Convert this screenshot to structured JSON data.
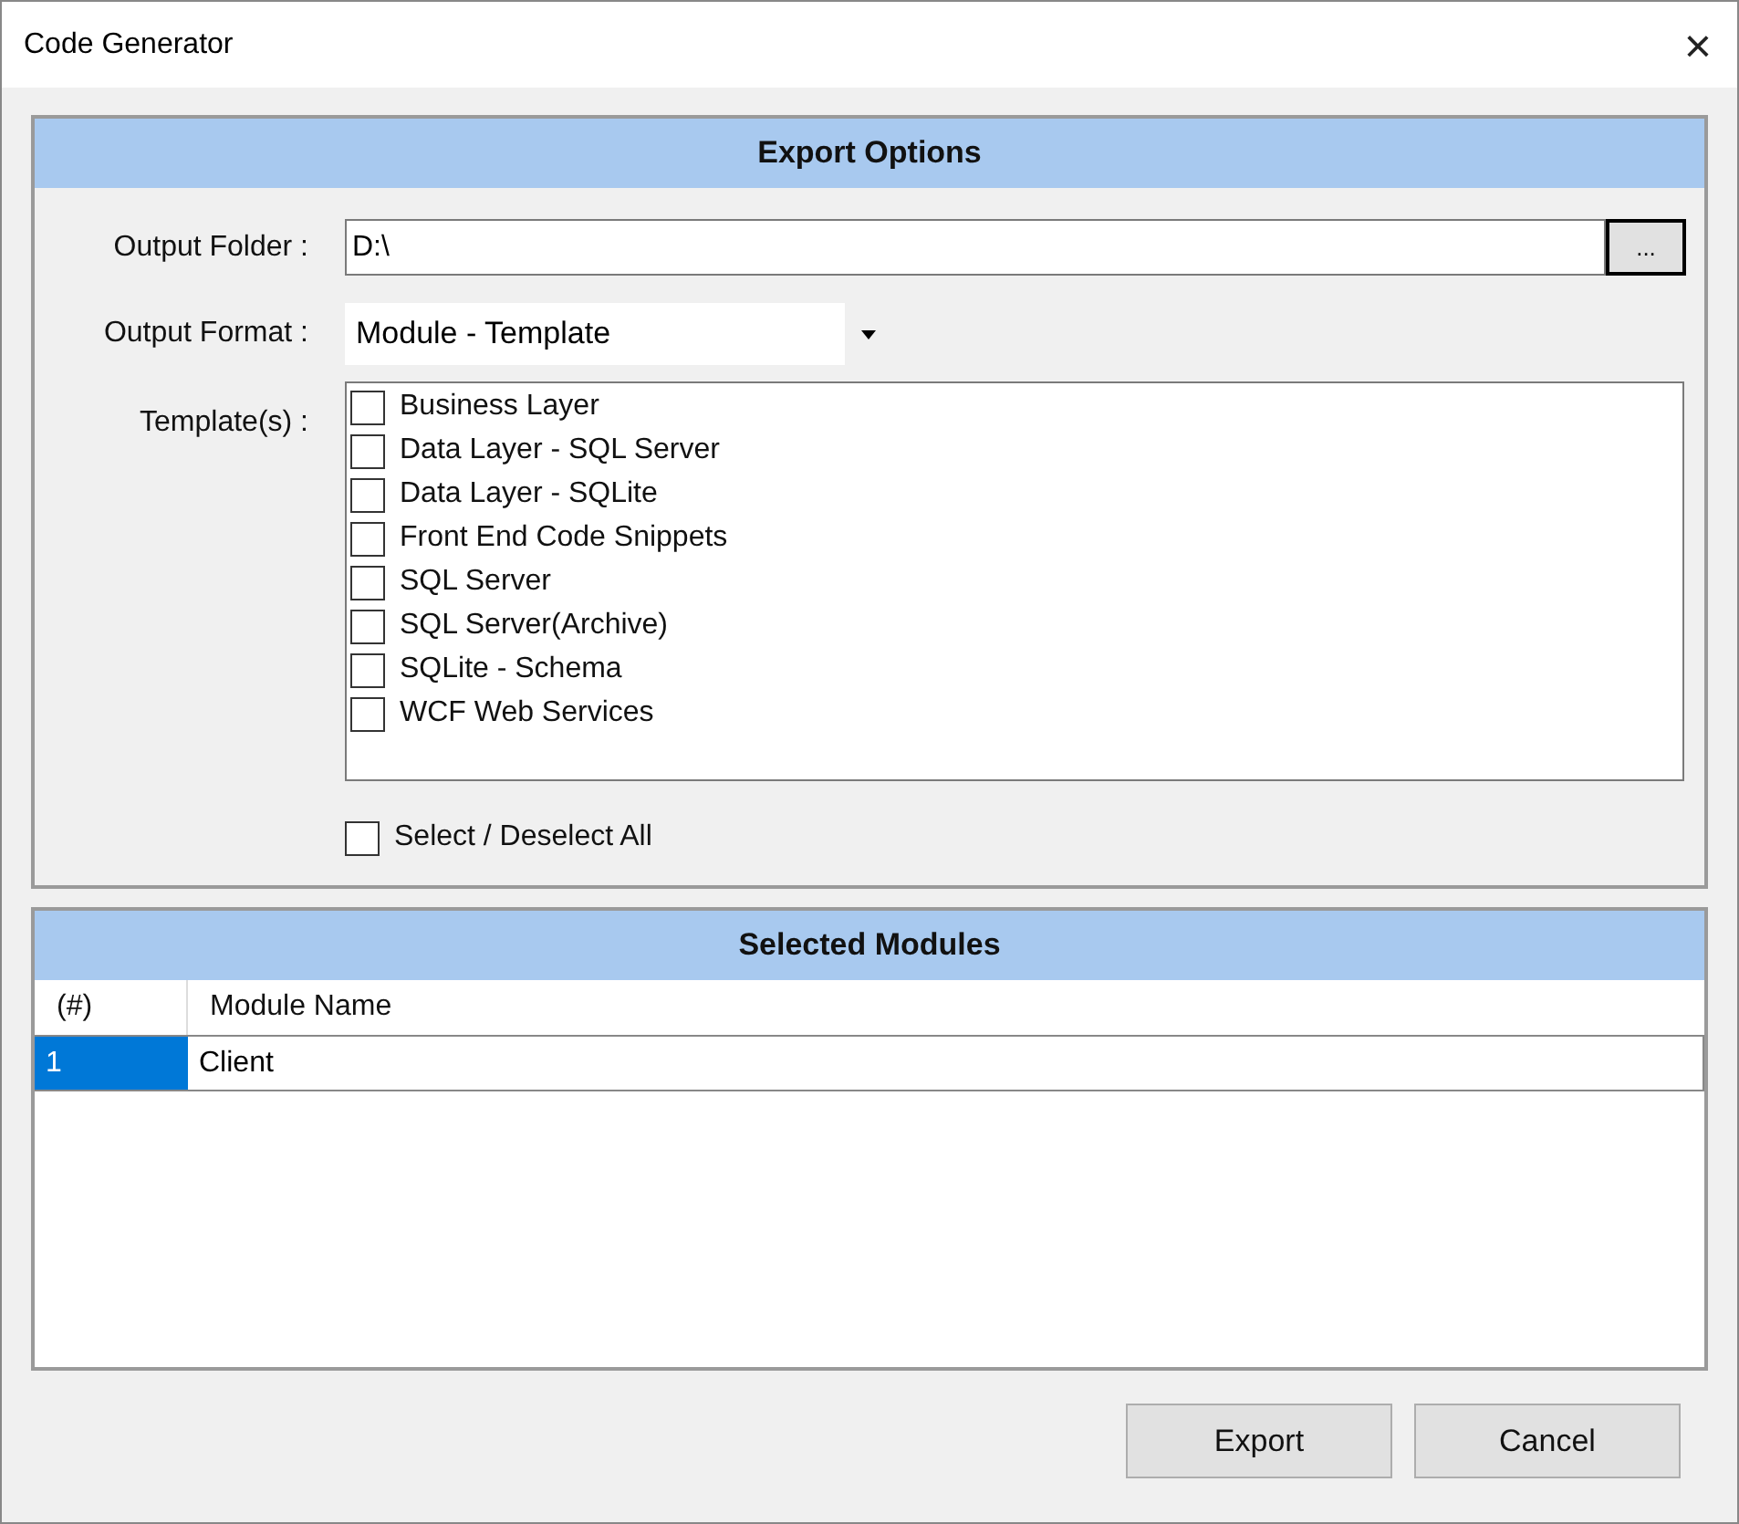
{
  "window": {
    "title": "Code Generator",
    "close": "×"
  },
  "export_options": {
    "title": "Export Options",
    "output_folder": {
      "label": "Output Folder :",
      "value": "D:\\",
      "browse": "..."
    },
    "output_format": {
      "label": "Output Format :",
      "value": "Module - Template"
    },
    "templates": {
      "label": "Template(s) :",
      "items": [
        {
          "label": "Business Layer",
          "checked": false
        },
        {
          "label": "Data Layer - SQL Server",
          "checked": false
        },
        {
          "label": "Data Layer - SQLite",
          "checked": false
        },
        {
          "label": "Front End Code Snippets",
          "checked": false
        },
        {
          "label": "SQL Server",
          "checked": false
        },
        {
          "label": "SQL Server(Archive)",
          "checked": false
        },
        {
          "label": "SQLite - Schema",
          "checked": false
        },
        {
          "label": "WCF Web Services",
          "checked": false
        }
      ]
    },
    "select_all": {
      "label": "Select / Deselect All",
      "checked": false
    }
  },
  "selected_modules": {
    "title": "Selected Modules",
    "columns": [
      "(#)",
      "Module Name"
    ],
    "rows": [
      {
        "cells": [
          "1",
          "Client"
        ],
        "selected": true
      }
    ]
  },
  "buttons": [
    "Export",
    "Cancel"
  ]
}
